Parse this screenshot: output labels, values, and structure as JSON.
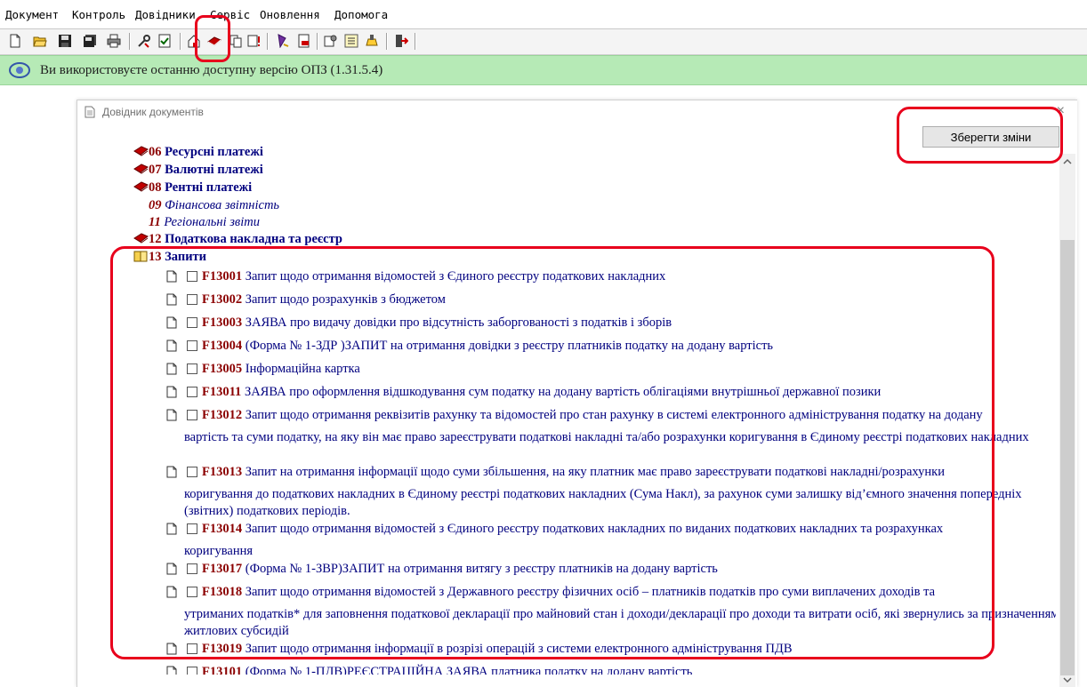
{
  "menu": {
    "items": [
      "Документ",
      "Контроль",
      "Довідники",
      "Сервіс",
      "Оновлення",
      "Допомога"
    ]
  },
  "toolbar": {
    "icons": [
      "new-icon",
      "open-icon",
      "save-icon",
      "save-all-icon",
      "print-icon",
      "tools-icon",
      "check-icon",
      "home-icon",
      "book-icon",
      "copy-icon",
      "doc-alert-icon",
      "sign-icon",
      "pdf-icon",
      "settings-icon",
      "list-icon",
      "stamp-icon",
      "exit-icon"
    ]
  },
  "infobar": {
    "text": "Ви використовуєте останню доступну версію ОПЗ (1.31.5.4)"
  },
  "dialog": {
    "title": "Довідник документів",
    "close": "×",
    "save_button": "Зберегти зміни"
  },
  "categories": [
    {
      "num": "06",
      "label": "Ресурсні платежі"
    },
    {
      "num": "07",
      "label": "Валютні платежі"
    },
    {
      "num": "08",
      "label": "Рентні платежі"
    },
    {
      "num": "09",
      "label": "Фінансова звітність"
    },
    {
      "num": "11",
      "label": "Регіональні звіти"
    },
    {
      "num": "12",
      "label": "Податкова накладна та реєстр"
    },
    {
      "num": "13",
      "label": "Запити"
    }
  ],
  "forms": [
    {
      "code": "F13001",
      "text": "Запит щодо отримання відомостей з Єдиного реєстру податкових накладних",
      "cont": ""
    },
    {
      "code": "F13002",
      "text": "Запит щодо розрахунків з бюджетом",
      "cont": ""
    },
    {
      "code": "F13003",
      "text": "ЗАЯВА про видачу довідки про відсутність заборгованості з податків і зборів",
      "cont": ""
    },
    {
      "code": "F13004",
      "text": "(Форма № 1-ЗДР )ЗАПИТ на отримання довідки з реєстру платників податку на додану вартість",
      "cont": ""
    },
    {
      "code": "F13005",
      "text": "Інформаційна картка",
      "cont": ""
    },
    {
      "code": "F13011",
      "text": "ЗАЯВА про оформлення відшкодування сум податку на додану вартість облігаціями внутрішньої державної позики",
      "cont": ""
    },
    {
      "code": "F13012",
      "text": "Запит щодо отримання реквізитів рахунку та відомостей про стан рахунку в системі електронного адміністрування податку на додану",
      "cont": "вартість та суми податку, на яку він має право зареєструвати податкові накладні та/або розрахунки коригування в Єдиному реєстрі податкових накладних"
    },
    {
      "code": "F13013",
      "text": "Запит на отримання інформації щодо суми збільшення, на яку платник має право зареєструвати податкові накладні/розрахунки",
      "cont": "коригування до податкових накладних в Єдиному реєстрі податкових накладних (Сума Накл), за рахунок суми залишку від’ємного значення попередніх (звітних) податкових періодів."
    },
    {
      "code": "F13014",
      "text": "Запит щодо отримання відомостей з Єдиного реєстру податкових накладних по виданих податкових накладних та розрахунках",
      "cont": "коригування"
    },
    {
      "code": "F13017",
      "text": "(Форма № 1-ЗВР)ЗАПИТ на отримання витягу з реєстру платників на додану вартість",
      "cont": ""
    },
    {
      "code": "F13018",
      "text": "Запит щодо отримання відомостей з Державного реєстру фізичних осіб – платників податків про суми виплачених доходів та",
      "cont": "утриманих податків* для заповнення податкової декларації про майновий стан і доходи/декларації про доходи та витрати осіб, які звернулись за призначенням житлових субсидій"
    },
    {
      "code": "F13019",
      "text": "Запит щодо отримання інформації в розрізі операцій з системи електронного адміністрування ПДВ",
      "cont": ""
    },
    {
      "code": "F13101",
      "text": "(Форма № 1-ПДВ)РЕЄСТРАЦІЙНА ЗАЯВА платника податку на додану вартість",
      "cont": ""
    }
  ],
  "colors": {
    "infobar_bg": "#b6eab6",
    "code": "#8b0000",
    "label": "#00007f",
    "annotation": "#e8001c"
  }
}
